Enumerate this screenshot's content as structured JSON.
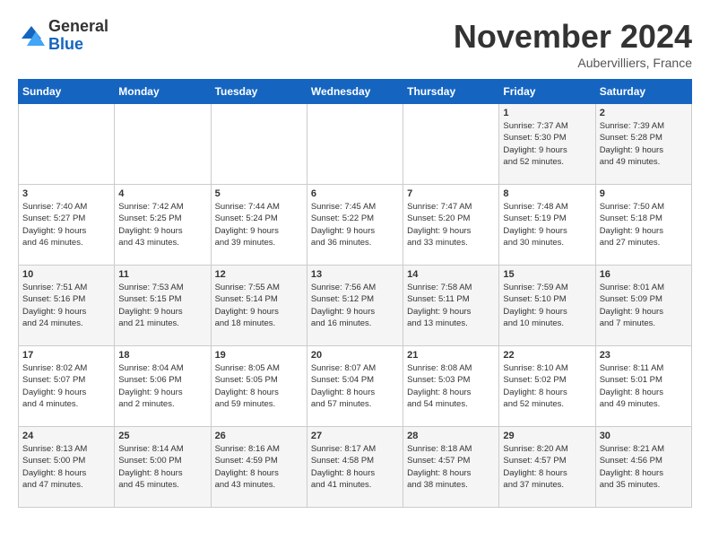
{
  "logo": {
    "general": "General",
    "blue": "Blue"
  },
  "title": "November 2024",
  "location": "Aubervilliers, France",
  "weekdays": [
    "Sunday",
    "Monday",
    "Tuesday",
    "Wednesday",
    "Thursday",
    "Friday",
    "Saturday"
  ],
  "weeks": [
    [
      {
        "day": "",
        "info": ""
      },
      {
        "day": "",
        "info": ""
      },
      {
        "day": "",
        "info": ""
      },
      {
        "day": "",
        "info": ""
      },
      {
        "day": "",
        "info": ""
      },
      {
        "day": "1",
        "info": "Sunrise: 7:37 AM\nSunset: 5:30 PM\nDaylight: 9 hours\nand 52 minutes."
      },
      {
        "day": "2",
        "info": "Sunrise: 7:39 AM\nSunset: 5:28 PM\nDaylight: 9 hours\nand 49 minutes."
      }
    ],
    [
      {
        "day": "3",
        "info": "Sunrise: 7:40 AM\nSunset: 5:27 PM\nDaylight: 9 hours\nand 46 minutes."
      },
      {
        "day": "4",
        "info": "Sunrise: 7:42 AM\nSunset: 5:25 PM\nDaylight: 9 hours\nand 43 minutes."
      },
      {
        "day": "5",
        "info": "Sunrise: 7:44 AM\nSunset: 5:24 PM\nDaylight: 9 hours\nand 39 minutes."
      },
      {
        "day": "6",
        "info": "Sunrise: 7:45 AM\nSunset: 5:22 PM\nDaylight: 9 hours\nand 36 minutes."
      },
      {
        "day": "7",
        "info": "Sunrise: 7:47 AM\nSunset: 5:20 PM\nDaylight: 9 hours\nand 33 minutes."
      },
      {
        "day": "8",
        "info": "Sunrise: 7:48 AM\nSunset: 5:19 PM\nDaylight: 9 hours\nand 30 minutes."
      },
      {
        "day": "9",
        "info": "Sunrise: 7:50 AM\nSunset: 5:18 PM\nDaylight: 9 hours\nand 27 minutes."
      }
    ],
    [
      {
        "day": "10",
        "info": "Sunrise: 7:51 AM\nSunset: 5:16 PM\nDaylight: 9 hours\nand 24 minutes."
      },
      {
        "day": "11",
        "info": "Sunrise: 7:53 AM\nSunset: 5:15 PM\nDaylight: 9 hours\nand 21 minutes."
      },
      {
        "day": "12",
        "info": "Sunrise: 7:55 AM\nSunset: 5:14 PM\nDaylight: 9 hours\nand 18 minutes."
      },
      {
        "day": "13",
        "info": "Sunrise: 7:56 AM\nSunset: 5:12 PM\nDaylight: 9 hours\nand 16 minutes."
      },
      {
        "day": "14",
        "info": "Sunrise: 7:58 AM\nSunset: 5:11 PM\nDaylight: 9 hours\nand 13 minutes."
      },
      {
        "day": "15",
        "info": "Sunrise: 7:59 AM\nSunset: 5:10 PM\nDaylight: 9 hours\nand 10 minutes."
      },
      {
        "day": "16",
        "info": "Sunrise: 8:01 AM\nSunset: 5:09 PM\nDaylight: 9 hours\nand 7 minutes."
      }
    ],
    [
      {
        "day": "17",
        "info": "Sunrise: 8:02 AM\nSunset: 5:07 PM\nDaylight: 9 hours\nand 4 minutes."
      },
      {
        "day": "18",
        "info": "Sunrise: 8:04 AM\nSunset: 5:06 PM\nDaylight: 9 hours\nand 2 minutes."
      },
      {
        "day": "19",
        "info": "Sunrise: 8:05 AM\nSunset: 5:05 PM\nDaylight: 8 hours\nand 59 minutes."
      },
      {
        "day": "20",
        "info": "Sunrise: 8:07 AM\nSunset: 5:04 PM\nDaylight: 8 hours\nand 57 minutes."
      },
      {
        "day": "21",
        "info": "Sunrise: 8:08 AM\nSunset: 5:03 PM\nDaylight: 8 hours\nand 54 minutes."
      },
      {
        "day": "22",
        "info": "Sunrise: 8:10 AM\nSunset: 5:02 PM\nDaylight: 8 hours\nand 52 minutes."
      },
      {
        "day": "23",
        "info": "Sunrise: 8:11 AM\nSunset: 5:01 PM\nDaylight: 8 hours\nand 49 minutes."
      }
    ],
    [
      {
        "day": "24",
        "info": "Sunrise: 8:13 AM\nSunset: 5:00 PM\nDaylight: 8 hours\nand 47 minutes."
      },
      {
        "day": "25",
        "info": "Sunrise: 8:14 AM\nSunset: 5:00 PM\nDaylight: 8 hours\nand 45 minutes."
      },
      {
        "day": "26",
        "info": "Sunrise: 8:16 AM\nSunset: 4:59 PM\nDaylight: 8 hours\nand 43 minutes."
      },
      {
        "day": "27",
        "info": "Sunrise: 8:17 AM\nSunset: 4:58 PM\nDaylight: 8 hours\nand 41 minutes."
      },
      {
        "day": "28",
        "info": "Sunrise: 8:18 AM\nSunset: 4:57 PM\nDaylight: 8 hours\nand 38 minutes."
      },
      {
        "day": "29",
        "info": "Sunrise: 8:20 AM\nSunset: 4:57 PM\nDaylight: 8 hours\nand 37 minutes."
      },
      {
        "day": "30",
        "info": "Sunrise: 8:21 AM\nSunset: 4:56 PM\nDaylight: 8 hours\nand 35 minutes."
      }
    ]
  ]
}
